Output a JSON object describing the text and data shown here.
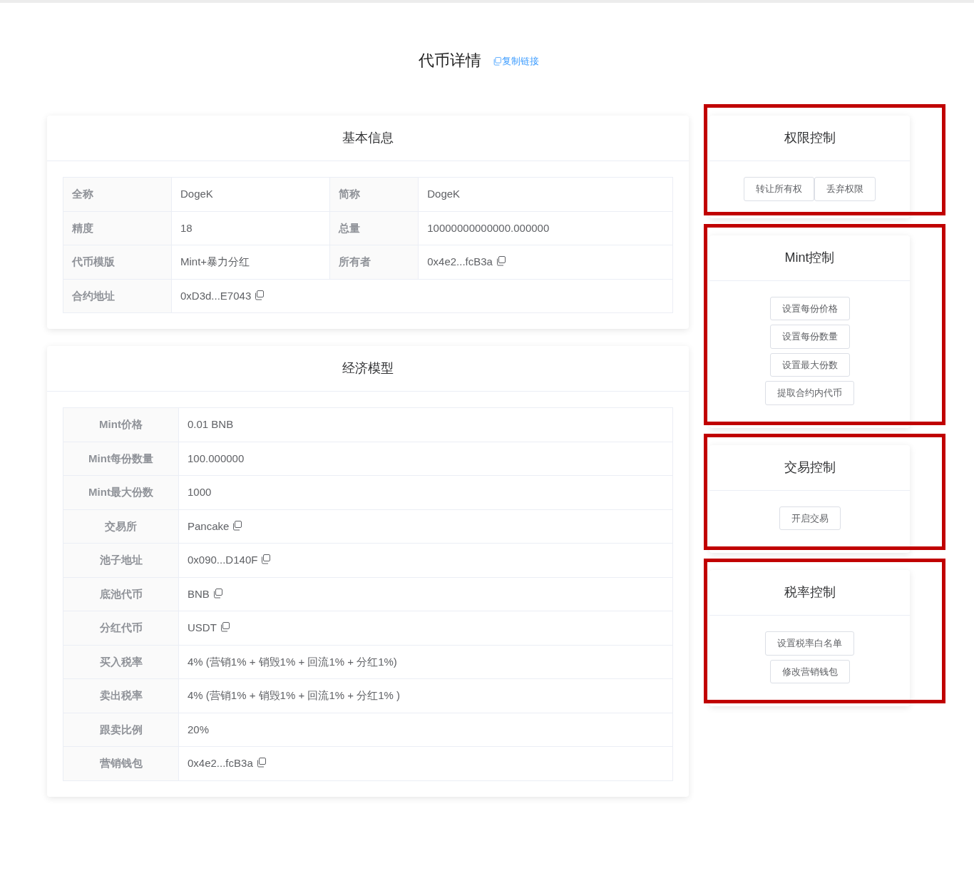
{
  "page_title": "代币详情",
  "copy_link": "复制链接",
  "basic_info": {
    "title": "基本信息",
    "rows": [
      [
        {
          "label": "全称",
          "value": "DogeK",
          "copyable": false
        },
        {
          "label": "简称",
          "value": "DogeK",
          "copyable": false
        }
      ],
      [
        {
          "label": "精度",
          "value": "18",
          "copyable": false
        },
        {
          "label": "总量",
          "value": "10000000000000.000000",
          "copyable": false
        }
      ],
      [
        {
          "label": "代币模版",
          "value": "Mint+暴力分红",
          "copyable": false
        },
        {
          "label": "所有者",
          "value": "0x4e2...fcB3a",
          "copyable": true
        }
      ],
      [
        {
          "label": "合约地址",
          "value": "0xD3d...E7043",
          "copyable": true
        }
      ]
    ]
  },
  "economic_model": {
    "title": "经济模型",
    "rows": [
      {
        "label": "Mint价格",
        "value": "0.01 BNB",
        "copyable": false
      },
      {
        "label": "Mint每份数量",
        "value": "100.000000",
        "copyable": false
      },
      {
        "label": "Mint最大份数",
        "value": "1000",
        "copyable": false
      },
      {
        "label": "交易所",
        "value": "Pancake",
        "copyable": true
      },
      {
        "label": "池子地址",
        "value": "0x090...D140F",
        "copyable": true
      },
      {
        "label": "底池代币",
        "value": "BNB",
        "copyable": true
      },
      {
        "label": "分红代币",
        "value": "USDT",
        "copyable": true
      },
      {
        "label": "买入税率",
        "value": "4% (营销1% + 销毁1% + 回流1% + 分红1%)",
        "copyable": false
      },
      {
        "label": "卖出税率",
        "value": "4% (营销1% + 销毁1% + 回流1% + 分红1% )",
        "copyable": false
      },
      {
        "label": "跟卖比例",
        "value": "20%",
        "copyable": false
      },
      {
        "label": "营销钱包",
        "value": "0x4e2...fcB3a",
        "copyable": true
      }
    ]
  },
  "control_panels": [
    {
      "title": "权限控制",
      "highlighted": true,
      "kind": "row",
      "buttons": [
        "转让所有权",
        "丢弃权限"
      ]
    },
    {
      "title": "Mint控制",
      "highlighted": true,
      "kind": "column",
      "buttons": [
        "设置每份价格",
        "设置每份数量",
        "设置最大份数",
        "提取合约内代币"
      ]
    },
    {
      "title": "交易控制",
      "highlighted": true,
      "kind": "column",
      "buttons": [
        "开启交易"
      ]
    },
    {
      "title": "税率控制",
      "highlighted": true,
      "kind": "column",
      "buttons": [
        "设置税率白名单",
        "修改营销钱包"
      ]
    }
  ]
}
